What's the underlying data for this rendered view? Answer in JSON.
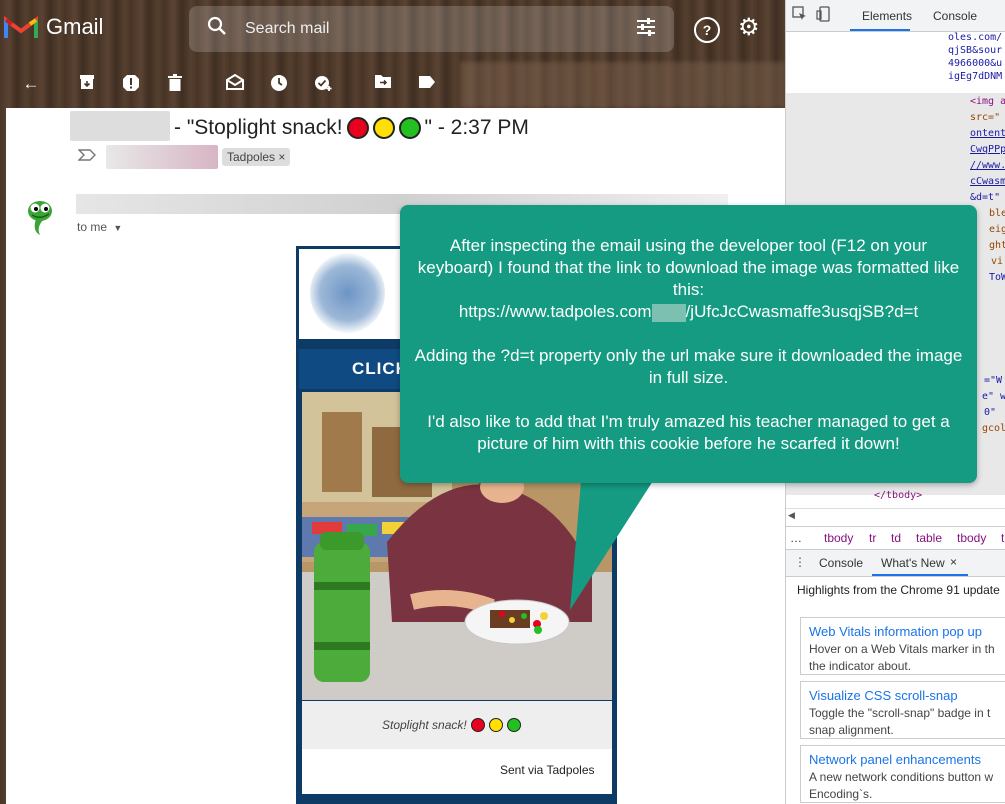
{
  "gmail": {
    "app_name": "Gmail",
    "search_placeholder": "Search mail",
    "help_icon_text": "?",
    "icons": [
      "back-arrow-icon",
      "archive-icon",
      "report-spam-icon",
      "delete-icon",
      "mark-unread-icon",
      "snooze-icon",
      "add-task-icon",
      "move-to-icon",
      "labels-icon",
      "more-icon"
    ]
  },
  "email": {
    "subject_before": "- \"Stoplight snack!",
    "subject_after": "\" - 2:37 PM",
    "label_chip": "Tadpoles",
    "label_chip_close": "×",
    "recipient": "to me",
    "card_banner": "CLICK",
    "caption": "Stoplight snack!",
    "footer": "Sent via Tadpoles"
  },
  "callout": {
    "p1_line1": "After inspecting the email using the developer tool (F12 on your keyboard) I found that the link to download the image was formatted like this:",
    "url_start": "https://www.tadpoles.com",
    "url_end": "/jUfcJcCwasmaffe3usqjSB?d=t",
    "p2": "Adding the ?d=t property only the url make sure it downloaded the image in full size.",
    "p3": "I'd also like to add that I'm truly amazed his teacher managed to get a picture of him with this cookie before he scarfed it down!"
  },
  "devtools": {
    "tab_elements": "Elements",
    "tab_console": "Console",
    "code_lines": [
      "oles.com/",
      "qjSB&sour",
      "4966000&u",
      "igEg7dDNM",
      "<img a",
      "src=\"",
      "ontent",
      "CwqPPp",
      "//www.",
      "cCwasm",
      "&d=t\"",
      "ble",
      "eig",
      "ght",
      "vi",
      "ToW",
      "=\"W",
      "e\" w",
      "0\"",
      "gcol",
      "</tbody>"
    ],
    "breadcrumb": [
      "tbody",
      "tr",
      "td",
      "table",
      "tbody",
      "t"
    ],
    "drawer_console": "Console",
    "drawer_whatsnew": "What's New",
    "drawer_close": "×",
    "highlights": "Highlights from the Chrome 91 update",
    "whatsnew_items": [
      {
        "title": "Web Vitals information pop up",
        "desc1": "Hover on a Web Vitals marker in th",
        "desc2": "the indicator about."
      },
      {
        "title": "Visualize CSS scroll-snap",
        "desc1": "Toggle the \"scroll-snap\" badge in t",
        "desc2": "snap alignment."
      },
      {
        "title": "Network panel enhancements",
        "desc1": "A new network conditions button w",
        "desc2": "Encoding`s."
      }
    ]
  }
}
